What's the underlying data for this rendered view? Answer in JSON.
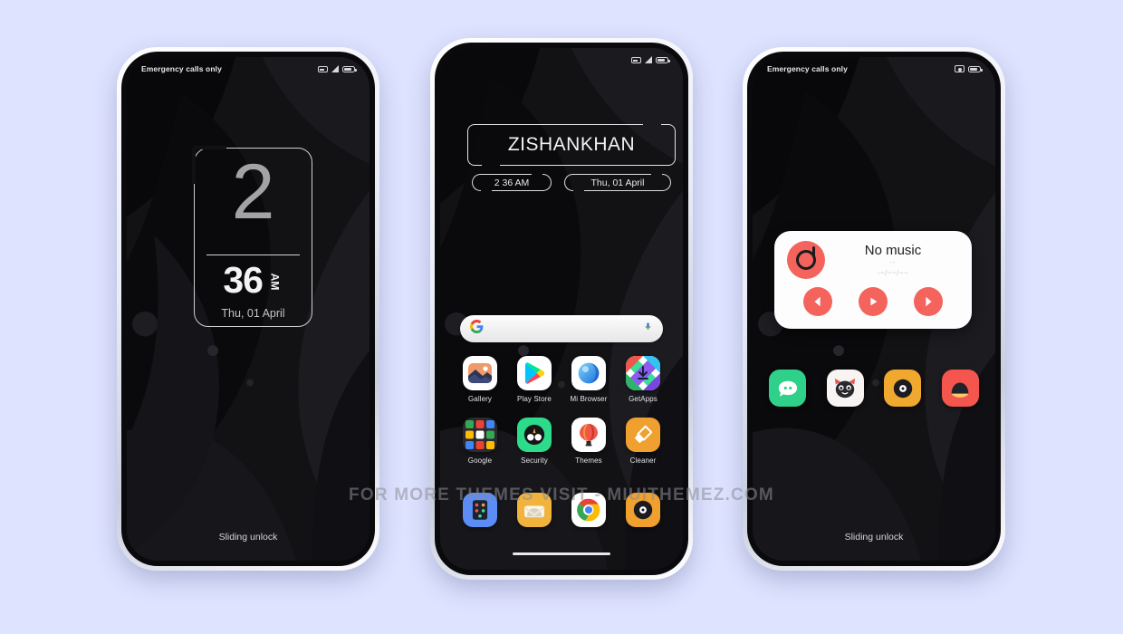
{
  "background_color": "#dee3ff",
  "watermark": "FOR MORE THEMES VISIT - MIUITHEMEZ.COM",
  "accent_colors": {
    "music_widget": "#f4635c",
    "clock_digit": "#a3a3a6",
    "wallpaper": "#121215"
  },
  "lockscreen": {
    "status": {
      "carrier": "Emergency calls only",
      "icons": [
        "sim-icon",
        "signal-icon",
        "battery-icon"
      ]
    },
    "clock": {
      "hour": "2",
      "minute": "36",
      "meridiem": "AM",
      "date": "Thu, 01 April"
    },
    "unlock_hint": "Sliding unlock"
  },
  "homescreen": {
    "status": {
      "carrier": "",
      "icons": [
        "sim-icon",
        "signal-icon",
        "battery-icon"
      ]
    },
    "name_widget": {
      "name": "ZISHANKHAN",
      "time": "2 36 AM",
      "date": "Thu, 01 April"
    },
    "search": {
      "placeholder": "",
      "left_icon": "google-g-icon",
      "right_icon": "microphone-icon"
    },
    "app_rows": [
      [
        {
          "label": "Gallery",
          "icon": "gallery-icon"
        },
        {
          "label": "Play Store",
          "icon": "play-store-icon"
        },
        {
          "label": "Mi Browser",
          "icon": "mi-browser-icon"
        },
        {
          "label": "GetApps",
          "icon": "getapps-icon"
        }
      ],
      [
        {
          "label": "Google",
          "icon": "google-folder-icon"
        },
        {
          "label": "Security",
          "icon": "security-icon"
        },
        {
          "label": "Themes",
          "icon": "themes-icon"
        },
        {
          "label": "Cleaner",
          "icon": "cleaner-icon"
        }
      ]
    ],
    "dock": [
      {
        "label": "",
        "icon": "phone-dialer-icon"
      },
      {
        "label": "",
        "icon": "messages-icon"
      },
      {
        "label": "",
        "icon": "chrome-icon"
      },
      {
        "label": "",
        "icon": "music-player-icon"
      }
    ]
  },
  "third_screen": {
    "status": {
      "carrier": "Emergency calls only",
      "icons": [
        "camera-icon",
        "battery-icon"
      ]
    },
    "music": {
      "title": "No music",
      "subtitle": "--",
      "waveform": "-~/~~/~~",
      "album_icon": "music-disc-icon",
      "controls": [
        {
          "name": "previous-button",
          "glyph": "prev"
        },
        {
          "name": "play-button",
          "glyph": "play"
        },
        {
          "name": "next-button",
          "glyph": "next"
        }
      ]
    },
    "apps": [
      {
        "icon": "chat-bubble-icon"
      },
      {
        "icon": "cat-face-icon"
      },
      {
        "icon": "music-circle-icon"
      },
      {
        "icon": "capsule-icon"
      }
    ],
    "unlock_hint": "Sliding unlock"
  }
}
